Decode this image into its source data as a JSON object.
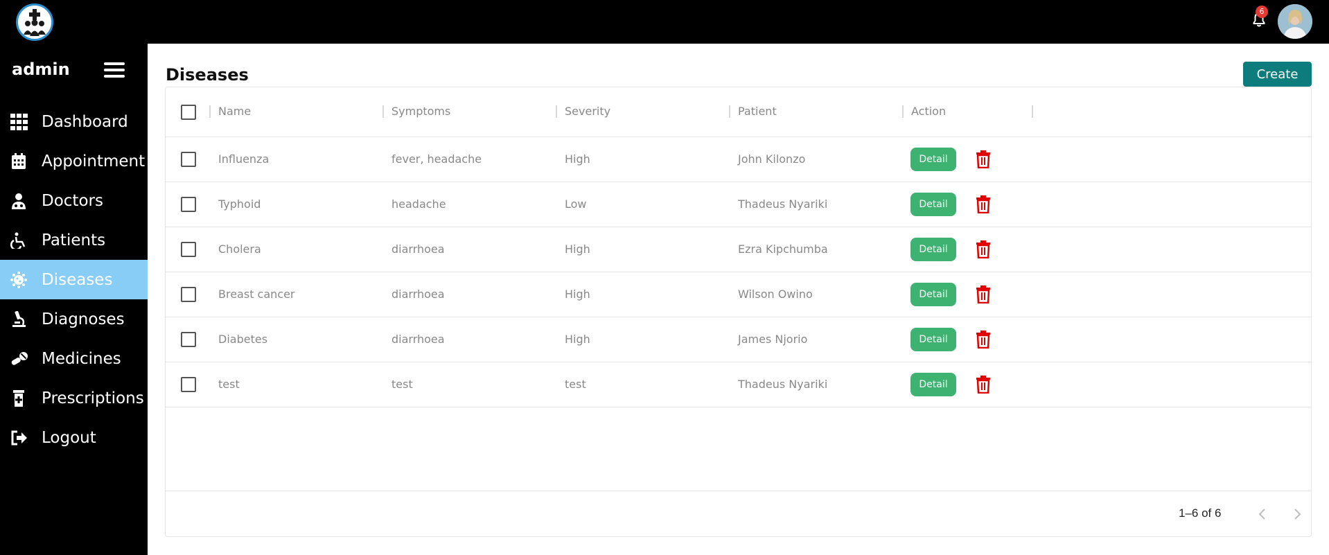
{
  "header": {
    "notification_count": "6"
  },
  "sidebar": {
    "user_label": "admin",
    "items": [
      {
        "label": "Dashboard",
        "icon": "grid-icon"
      },
      {
        "label": "Appointment",
        "icon": "calendar-icon"
      },
      {
        "label": "Doctors",
        "icon": "doctor-icon"
      },
      {
        "label": "Patients",
        "icon": "wheelchair-icon"
      },
      {
        "label": "Diseases",
        "icon": "virus-icon",
        "active": true
      },
      {
        "label": "Diagnoses",
        "icon": "microscope-icon"
      },
      {
        "label": "Medicines",
        "icon": "pills-icon"
      },
      {
        "label": "Prescriptions",
        "icon": "prescription-bottle-icon"
      },
      {
        "label": "Logout",
        "icon": "logout-icon"
      }
    ],
    "active_color": "#87cdf6"
  },
  "main": {
    "title": "Diseases",
    "create_label": "Create",
    "columns": [
      "Name",
      "Symptoms",
      "Severity",
      "Patient",
      "Action"
    ],
    "rows": [
      {
        "name": "Influenza",
        "symptoms": "fever, headache",
        "severity": "High",
        "patient": "John Kilonzo",
        "detail_label": "Detail"
      },
      {
        "name": "Typhoid",
        "symptoms": "headache",
        "severity": "Low",
        "patient": "Thadeus Nyariki",
        "detail_label": "Detail"
      },
      {
        "name": "Cholera",
        "symptoms": "diarrhoea",
        "severity": "High",
        "patient": "Ezra Kipchumba",
        "detail_label": "Detail"
      },
      {
        "name": "Breast cancer",
        "symptoms": "diarrhoea",
        "severity": "High",
        "patient": "Wilson Owino",
        "detail_label": "Detail"
      },
      {
        "name": "Diabetes",
        "symptoms": "diarrhoea",
        "severity": "High",
        "patient": "James Njorio",
        "detail_label": "Detail"
      },
      {
        "name": "test",
        "symptoms": "test",
        "severity": "test",
        "patient": "Thadeus Nyariki",
        "detail_label": "Detail"
      }
    ],
    "pagination": {
      "info": "1–6 of 6"
    },
    "colors": {
      "create_button": "#0d7c7c",
      "detail_button": "#3db271",
      "delete_icon": "#e00000"
    }
  }
}
